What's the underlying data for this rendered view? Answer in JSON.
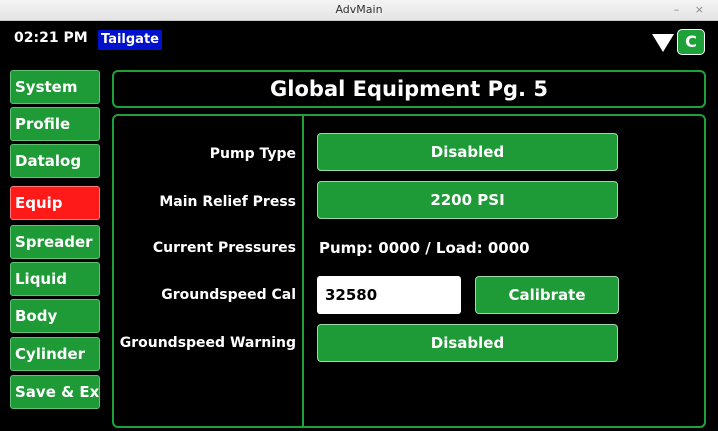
{
  "window": {
    "title": "AdvMain",
    "controls": "– ×"
  },
  "status": {
    "time": "02:21 PM",
    "vehicle": "Tailgate",
    "connection_icon": "signal-triangle-icon",
    "connection_badge": "C"
  },
  "colors": {
    "accent_green": "#1fa13a",
    "active_red": "#ff1a1a",
    "vehicle_blue": "#0011cc"
  },
  "nav": {
    "items": [
      {
        "label": "System"
      },
      {
        "label": "Profile"
      },
      {
        "label": "Datalog"
      },
      {
        "label": "Equip"
      },
      {
        "label": "Spreader"
      },
      {
        "label": "Liquid"
      },
      {
        "label": "Body"
      },
      {
        "label": "Cylinder"
      },
      {
        "label": "Save & Exit"
      }
    ],
    "active": "Equip"
  },
  "page": {
    "title": "Global Equipment Pg. 5"
  },
  "settings": {
    "pump_type": {
      "label": "Pump Type",
      "value": "Disabled"
    },
    "main_relief": {
      "label": "Main Relief Press",
      "value": "2200 PSI"
    },
    "current_pressures": {
      "label": "Current Pressures",
      "value": "Pump: 0000 / Load: 0000"
    },
    "groundspeed_cal": {
      "label": "Groundspeed Cal",
      "value": "32580",
      "button": "Calibrate"
    },
    "groundspeed_warning": {
      "label": "Groundspeed Warning",
      "value": "Disabled"
    }
  }
}
